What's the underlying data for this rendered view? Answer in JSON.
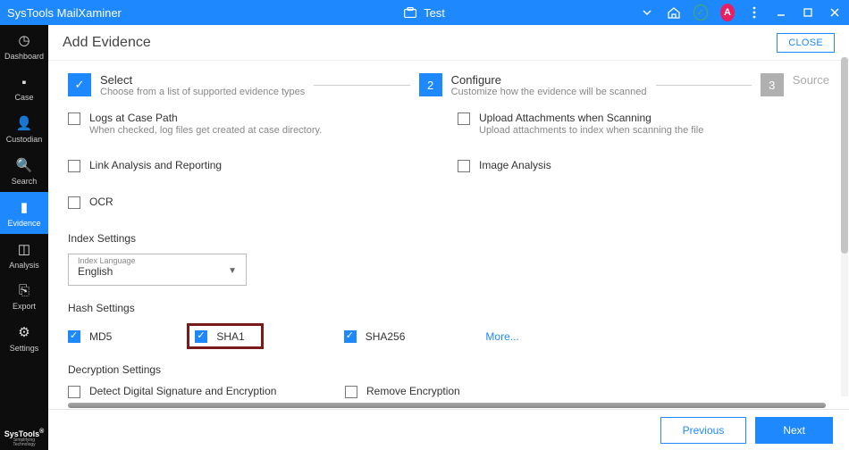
{
  "titlebar": {
    "app": "SysTools MailXaminer",
    "project": "Test",
    "avatar": "A"
  },
  "sidebar": {
    "items": [
      {
        "label": "Dashboard"
      },
      {
        "label": "Case"
      },
      {
        "label": "Custodian"
      },
      {
        "label": "Search"
      },
      {
        "label": "Evidence"
      },
      {
        "label": "Analysis"
      },
      {
        "label": "Export"
      },
      {
        "label": "Settings"
      }
    ],
    "logo": "SysTools",
    "logo_tag": "Simplifying Technology"
  },
  "header": {
    "title": "Add Evidence",
    "close": "CLOSE"
  },
  "steps": {
    "s1": {
      "title": "Select",
      "desc": "Choose from a list of supported evidence types"
    },
    "s2": {
      "num": "2",
      "title": "Configure",
      "desc": "Customize how the evidence will be scanned"
    },
    "s3": {
      "num": "3",
      "title": "Source"
    }
  },
  "opts": {
    "logs": {
      "title": "Logs at Case Path",
      "desc": "When checked, log files get created at case directory."
    },
    "upload": {
      "title": "Upload Attachments when Scanning",
      "desc": "Upload attachments to index when scanning the file"
    },
    "link": {
      "title": "Link Analysis and Reporting"
    },
    "image": {
      "title": "Image Analysis"
    },
    "ocr": {
      "title": "OCR"
    }
  },
  "index": {
    "section": "Index Settings",
    "label": "Index Language",
    "value": "English"
  },
  "hash": {
    "section": "Hash Settings",
    "md5": "MD5",
    "sha1": "SHA1",
    "sha256": "SHA256",
    "more": "More..."
  },
  "decrypt": {
    "section": "Decryption Settings",
    "sig": "Detect Digital Signature and Encryption",
    "remove": "Remove Encryption"
  },
  "footer": {
    "prev": "Previous",
    "next": "Next"
  }
}
